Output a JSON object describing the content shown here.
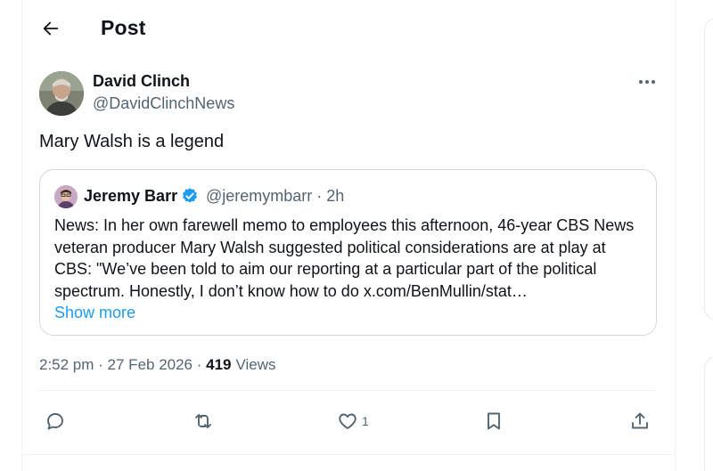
{
  "header": {
    "title": "Post",
    "back_icon": "arrow-left-icon"
  },
  "post": {
    "author": {
      "name": "David Clinch",
      "handle": "@DavidClinchNews"
    },
    "text": "Mary Walsh is a legend",
    "more_icon": "more-horizontal-icon"
  },
  "quote": {
    "author": {
      "name": "Jeremy Barr",
      "handle": "@jeremymbarr · 2h"
    },
    "text": "News: In her own farewell memo to employees this afternoon, 46-year CBS News veteran producer Mary Walsh suggested political considerations are at play at CBS: \"We’ve been told to aim our reporting at a particular part of the political spectrum. Honestly, I don’t know how to do x.com/BenMullin/stat…",
    "show_more": "Show more",
    "verified_color": "#1d9bf0"
  },
  "meta": {
    "time": "2:52 pm",
    "sep": " · ",
    "date": "27 Feb 2026",
    "views_count": "419",
    "views_label": "Views"
  },
  "actions": {
    "reply_icon": "reply-icon",
    "repost_icon": "repost-icon",
    "like_icon": "heart-icon",
    "like_count": "1",
    "bookmark_icon": "bookmark-icon",
    "share_icon": "share-icon"
  },
  "colors": {
    "text": "#0f1419",
    "secondary": "#536471",
    "link": "#1d9bf0",
    "border": "#cfd9de"
  }
}
